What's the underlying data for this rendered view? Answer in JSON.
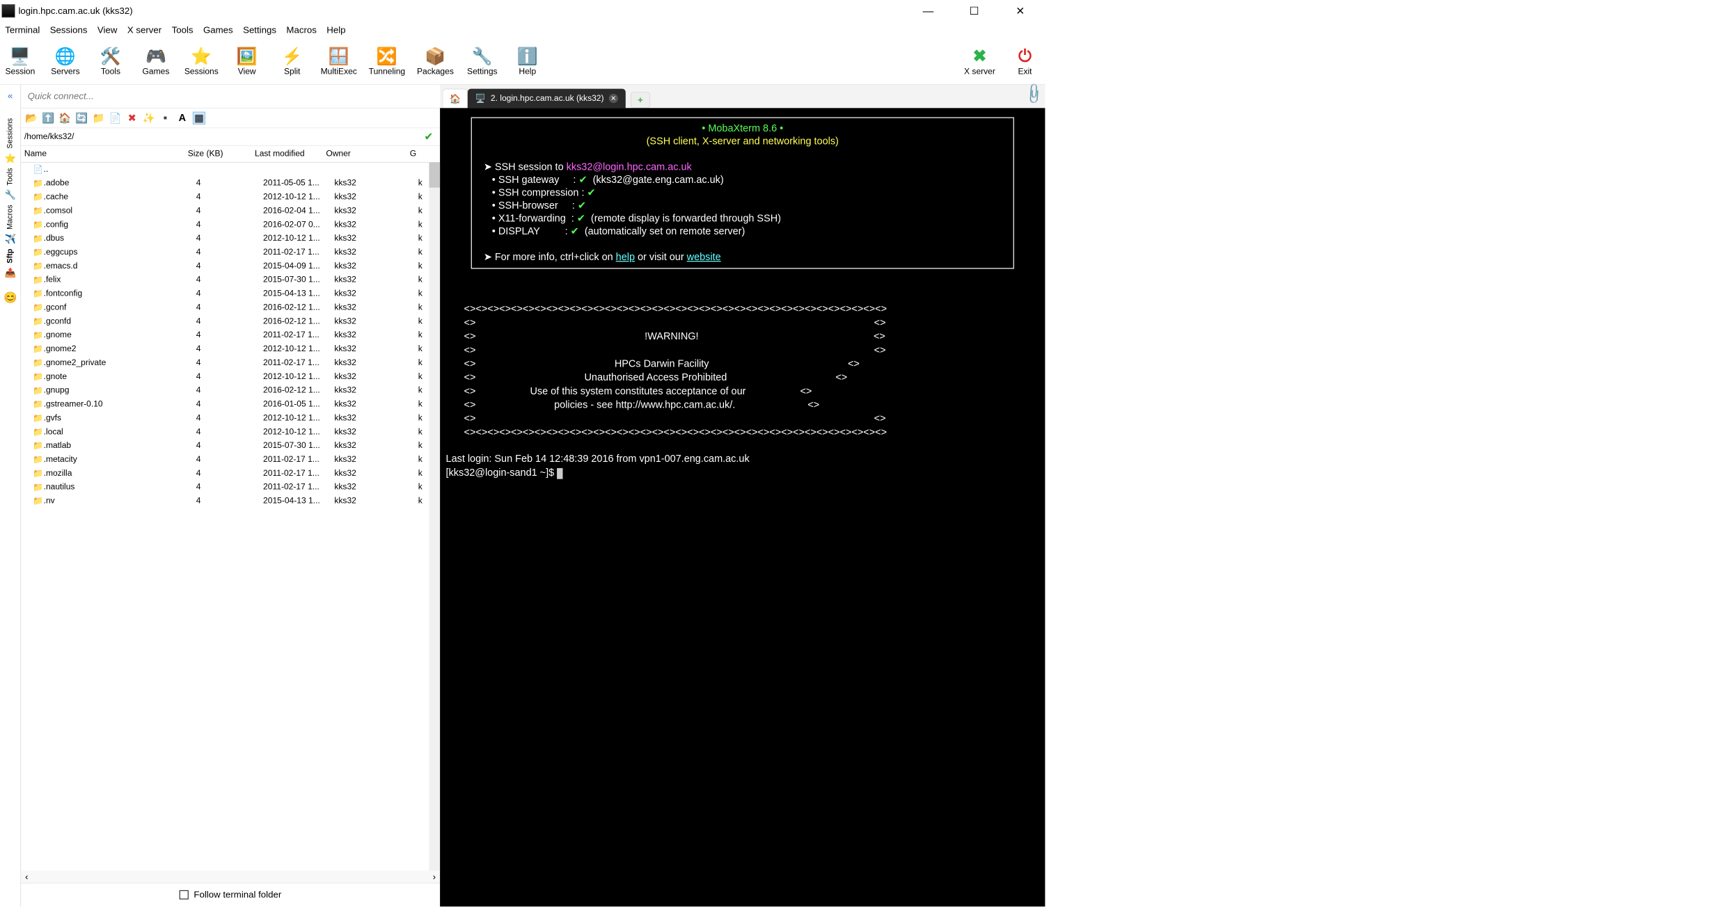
{
  "window": {
    "title": "login.hpc.cam.ac.uk (kks32)"
  },
  "menu": [
    "Terminal",
    "Sessions",
    "View",
    "X server",
    "Tools",
    "Games",
    "Settings",
    "Macros",
    "Help"
  ],
  "toolbar": [
    {
      "label": "Session",
      "icon": "🖥️"
    },
    {
      "label": "Servers",
      "icon": "🌐"
    },
    {
      "label": "Tools",
      "icon": "🛠️"
    },
    {
      "label": "Games",
      "icon": "🎮"
    },
    {
      "label": "Sessions",
      "icon": "⭐"
    },
    {
      "label": "View",
      "icon": "🖼️"
    },
    {
      "label": "Split",
      "icon": "⚡"
    },
    {
      "label": "MultiExec",
      "icon": "🪟"
    },
    {
      "label": "Tunneling",
      "icon": "🔀"
    },
    {
      "label": "Packages",
      "icon": "📦"
    },
    {
      "label": "Settings",
      "icon": "🔧"
    },
    {
      "label": "Help",
      "icon": "ℹ️"
    }
  ],
  "toolbar_right": [
    {
      "label": "X server",
      "icon": "✖",
      "color": "#29b34a"
    },
    {
      "label": "Exit",
      "icon": "⏻",
      "color": "#d22"
    }
  ],
  "quick_placeholder": "Quick connect...",
  "side_tabs": [
    "Sessions",
    "Tools",
    "Macros",
    "Sftp"
  ],
  "path": "/home/kks32/",
  "columns": [
    "Name",
    "Size (KB)",
    "Last modified",
    "Owner",
    "G"
  ],
  "parent_row": "..",
  "files": [
    {
      "n": ".adobe",
      "s": "4",
      "m": "2011-05-05 1...",
      "o": "kks32",
      "g": "k"
    },
    {
      "n": ".cache",
      "s": "4",
      "m": "2012-10-12 1...",
      "o": "kks32",
      "g": "k"
    },
    {
      "n": ".comsol",
      "s": "4",
      "m": "2016-02-04 1...",
      "o": "kks32",
      "g": "k"
    },
    {
      "n": ".config",
      "s": "4",
      "m": "2016-02-07 0...",
      "o": "kks32",
      "g": "k"
    },
    {
      "n": ".dbus",
      "s": "4",
      "m": "2012-10-12 1...",
      "o": "kks32",
      "g": "k"
    },
    {
      "n": ".eggcups",
      "s": "4",
      "m": "2011-02-17 1...",
      "o": "kks32",
      "g": "k"
    },
    {
      "n": ".emacs.d",
      "s": "4",
      "m": "2015-04-09 1...",
      "o": "kks32",
      "g": "k"
    },
    {
      "n": ".felix",
      "s": "4",
      "m": "2015-07-30 1...",
      "o": "kks32",
      "g": "k"
    },
    {
      "n": ".fontconfig",
      "s": "4",
      "m": "2015-04-13 1...",
      "o": "kks32",
      "g": "k"
    },
    {
      "n": ".gconf",
      "s": "4",
      "m": "2016-02-12 1...",
      "o": "kks32",
      "g": "k"
    },
    {
      "n": ".gconfd",
      "s": "4",
      "m": "2016-02-12 1...",
      "o": "kks32",
      "g": "k"
    },
    {
      "n": ".gnome",
      "s": "4",
      "m": "2011-02-17 1...",
      "o": "kks32",
      "g": "k"
    },
    {
      "n": ".gnome2",
      "s": "4",
      "m": "2012-10-12 1...",
      "o": "kks32",
      "g": "k"
    },
    {
      "n": ".gnome2_private",
      "s": "4",
      "m": "2011-02-17 1...",
      "o": "kks32",
      "g": "k"
    },
    {
      "n": ".gnote",
      "s": "4",
      "m": "2012-10-12 1...",
      "o": "kks32",
      "g": "k"
    },
    {
      "n": ".gnupg",
      "s": "4",
      "m": "2016-02-12 1...",
      "o": "kks32",
      "g": "k"
    },
    {
      "n": ".gstreamer-0.10",
      "s": "4",
      "m": "2016-01-05 1...",
      "o": "kks32",
      "g": "k"
    },
    {
      "n": ".gvfs",
      "s": "4",
      "m": "2012-10-12 1...",
      "o": "kks32",
      "g": "k"
    },
    {
      "n": ".local",
      "s": "4",
      "m": "2012-10-12 1...",
      "o": "kks32",
      "g": "k"
    },
    {
      "n": ".matlab",
      "s": "4",
      "m": "2015-07-30 1...",
      "o": "kks32",
      "g": "k"
    },
    {
      "n": ".metacity",
      "s": "4",
      "m": "2011-02-17 1...",
      "o": "kks32",
      "g": "k"
    },
    {
      "n": ".mozilla",
      "s": "4",
      "m": "2011-02-17 1...",
      "o": "kks32",
      "g": "k"
    },
    {
      "n": ".nautilus",
      "s": "4",
      "m": "2011-02-17 1...",
      "o": "kks32",
      "g": "k"
    },
    {
      "n": ".nv",
      "s": "4",
      "m": "2015-04-13 1...",
      "o": "kks32",
      "g": "k"
    }
  ],
  "follow_label": "Follow terminal folder",
  "tab": {
    "label": "2. login.hpc.cam.ac.uk (kks32)"
  },
  "term": {
    "title": "• MobaXterm 8.6 •",
    "subtitle": "(SSH client, X-server and networking tools)",
    "ssh_to_pre": "➤ SSH session to ",
    "ssh_to": "kks32@login.hpc.cam.ac.uk",
    "gw_l": "   • SSH gateway     : ",
    "gw_v": "(kks32@gate.eng.cam.ac.uk)",
    "cp_l": "   • SSH compression : ",
    "br_l": "   • SSH-browser     : ",
    "x11_l": "   • X11-forwarding  : ",
    "x11_v": "(remote display is forwarded through SSH)",
    "dsp_l": "   • DISPLAY         : ",
    "dsp_v": "(automatically set on remote server)",
    "info_pre": "➤ For more info, ctrl+click on ",
    "help": "help",
    "info_mid": " or visit our ",
    "website": "website",
    "border": "<><><><><><><><><><><><><><><><><><><><><><><><><><><><><><><><><><><><>",
    "bl": "<>",
    "br": "<>",
    "w1": "!WARNING!",
    "w2": "HPCs Darwin Facility",
    "w3": "Unauthorised Access Prohibited",
    "w4": "Use of this system constitutes acceptance of our",
    "w5": "policies - see http://www.hpc.cam.ac.uk/.",
    "last": "Last login: Sun Feb 14 12:48:39 2016 from vpn1-007.eng.cam.ac.uk",
    "prompt": "[kks32@login-sand1 ~]$ "
  }
}
